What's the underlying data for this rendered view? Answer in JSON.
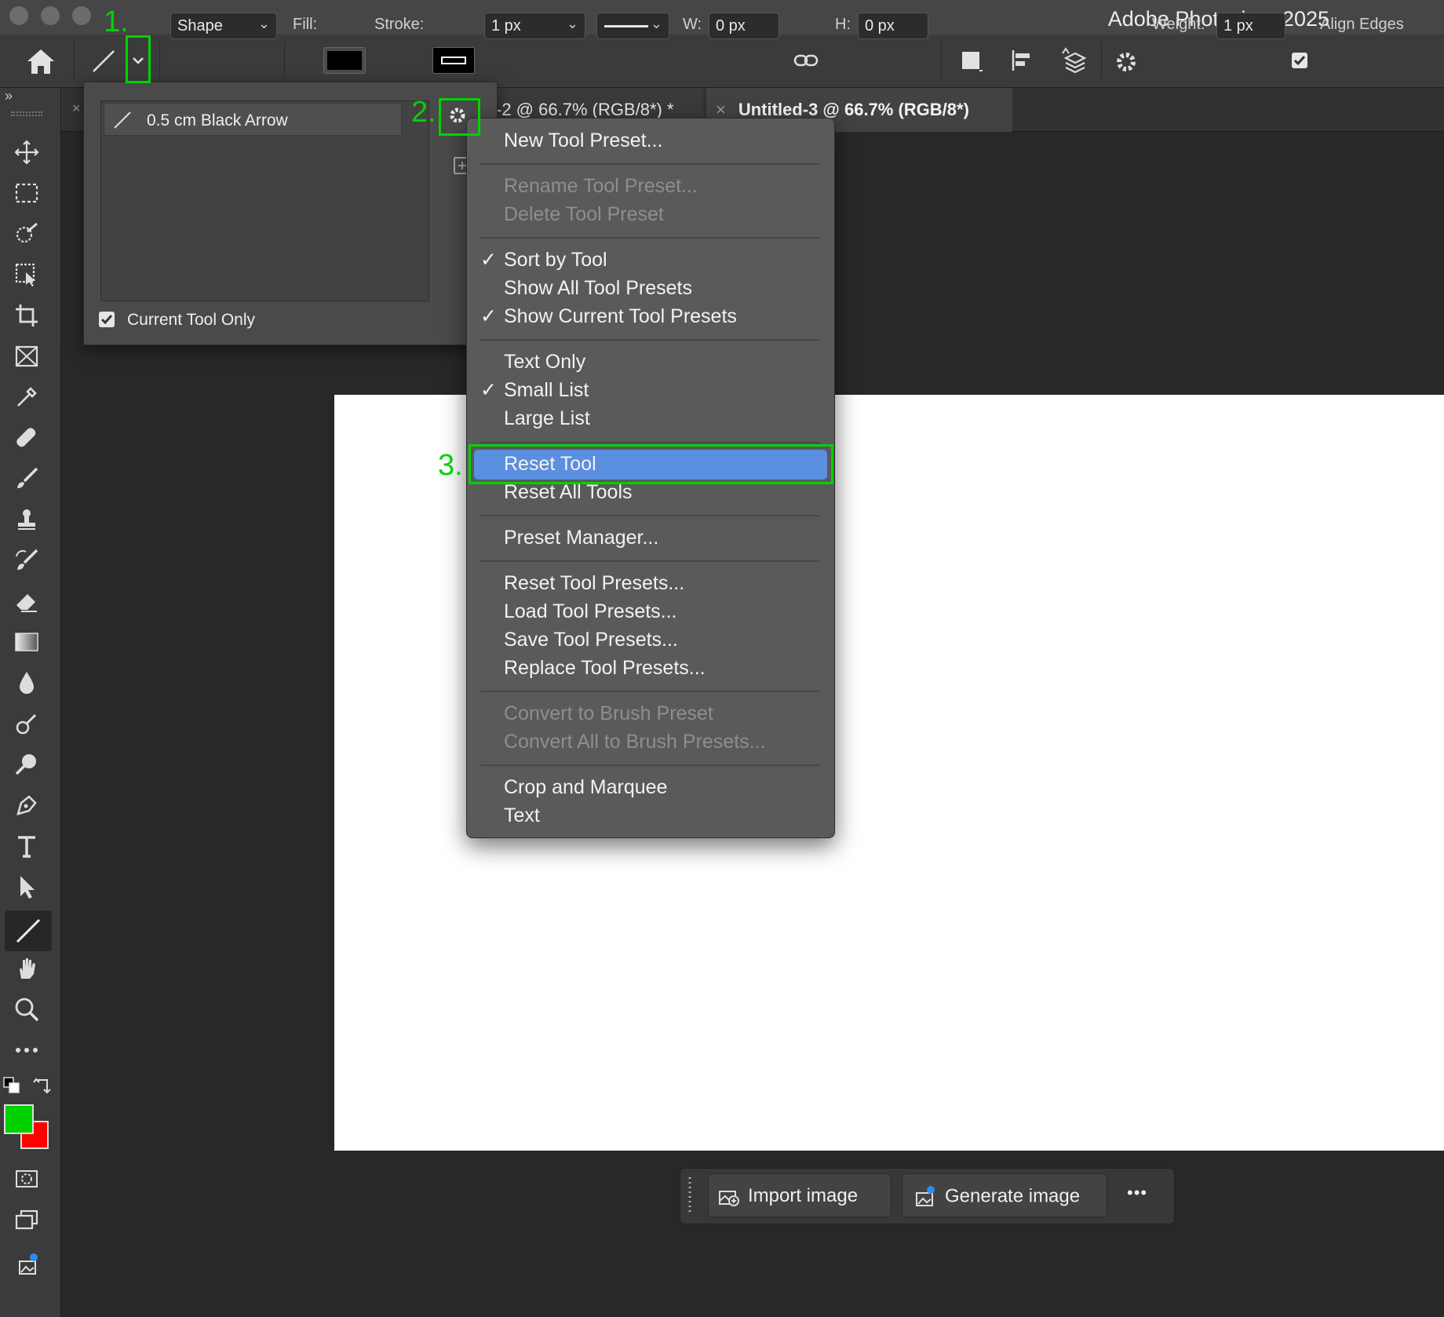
{
  "app": {
    "title": "Adobe Photoshop 2025"
  },
  "options_bar": {
    "mode": "Shape",
    "fill_label": "Fill:",
    "stroke_label": "Stroke:",
    "stroke_width": "1 px",
    "w_label": "W:",
    "w_value": "0 px",
    "h_label": "H:",
    "h_value": "0 px",
    "weight_label": "Weight:",
    "weight_value": "1 px",
    "align_edges_label": "Align Edges",
    "align_edges_checked": true,
    "fill_color": "#000000"
  },
  "tabs": [
    {
      "label": "-2 @ 66.7% (RGB/8*) *"
    },
    {
      "label": "Untitled-3 @ 66.7% (RGB/8*)"
    }
  ],
  "preset_panel": {
    "preset_name": "0.5 cm Black Arrow",
    "current_tool_only_label": "Current Tool Only",
    "current_tool_only_checked": true
  },
  "menu": {
    "new_tool_preset": "New Tool Preset...",
    "rename_tool_preset": "Rename Tool Preset...",
    "delete_tool_preset": "Delete Tool Preset",
    "sort_by_tool": "Sort by Tool",
    "show_all_tool_presets": "Show All Tool Presets",
    "show_current_tool_presets": "Show Current Tool Presets",
    "text_only": "Text Only",
    "small_list": "Small List",
    "large_list": "Large List",
    "reset_tool": "Reset Tool",
    "reset_all_tools": "Reset All Tools",
    "preset_manager": "Preset Manager...",
    "reset_tool_presets": "Reset Tool Presets...",
    "load_tool_presets": "Load Tool Presets...",
    "save_tool_presets": "Save Tool Presets...",
    "replace_tool_presets": "Replace Tool Presets...",
    "convert_to_brush_preset": "Convert to Brush Preset",
    "convert_all_to_brush_presets": "Convert All to Brush Presets...",
    "crop_and_marquee": "Crop and Marquee",
    "text": "Text",
    "check_mark": "✓"
  },
  "annotations": {
    "step1": "1.",
    "step2": "2.",
    "step3": "3."
  },
  "taskbar": {
    "import_image": "Import image",
    "generate_image": "Generate image",
    "more": "•••"
  },
  "colors": {
    "foreground": "#00d000",
    "background": "#ff0000",
    "annotation": "#00d200",
    "highlight": "#5b8fdf"
  }
}
